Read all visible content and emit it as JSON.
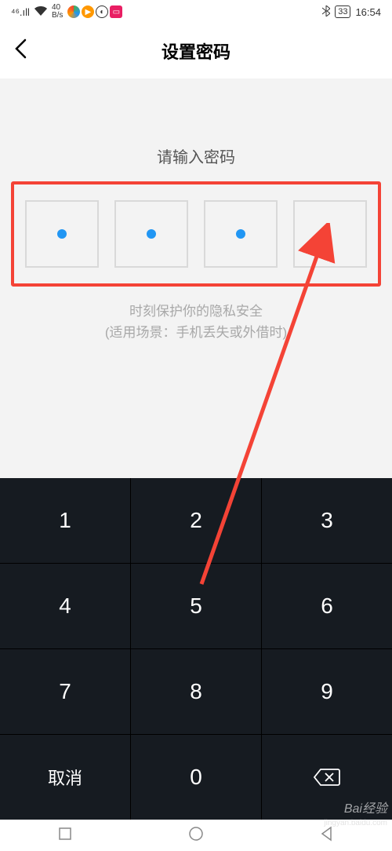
{
  "status": {
    "network": "4G",
    "speed_value": "40",
    "speed_unit": "B/s",
    "battery": "33",
    "time": "16:54"
  },
  "header": {
    "title": "设置密码"
  },
  "content": {
    "prompt": "请输入密码",
    "pin_filled": [
      true,
      true,
      true,
      false
    ],
    "hint_line1": "时刻保护你的隐私安全",
    "hint_line2": "(适用场景：手机丢失或外借时)"
  },
  "keypad": {
    "keys": [
      [
        "1",
        "2",
        "3"
      ],
      [
        "4",
        "5",
        "6"
      ],
      [
        "7",
        "8",
        "9"
      ]
    ],
    "cancel": "取消",
    "zero": "0"
  },
  "watermark": "Bai经验"
}
